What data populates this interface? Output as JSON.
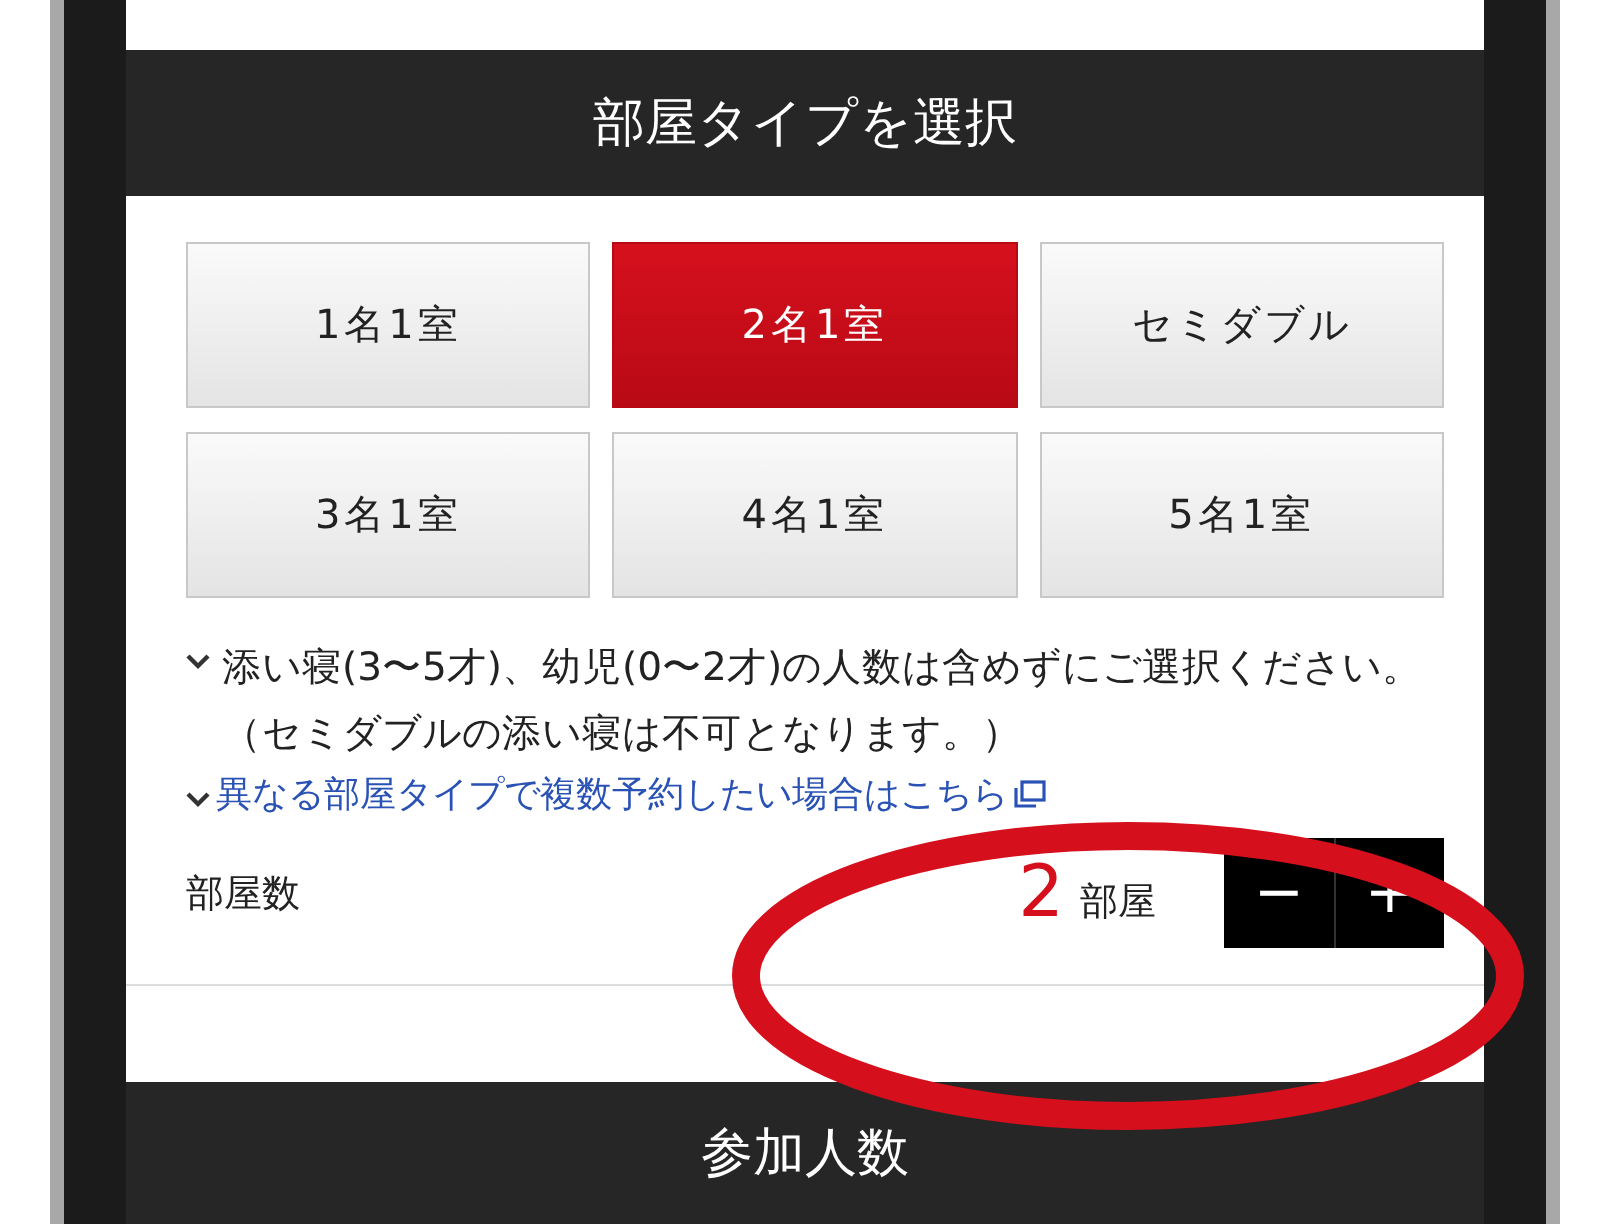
{
  "section_header": {
    "title": "部屋タイプを選択"
  },
  "room_types": [
    {
      "label": "1名1室",
      "selected": false
    },
    {
      "label": "2名1室",
      "selected": true
    },
    {
      "label": "セミダブル",
      "selected": false
    },
    {
      "label": "3名1室",
      "selected": false
    },
    {
      "label": "4名1室",
      "selected": false
    },
    {
      "label": "5名1室",
      "selected": false
    }
  ],
  "note": "添い寝(3〜5才)、幼児(0〜2才)の人数は含めずにご選択ください。（セミダブルの添い寝は不可となります。）",
  "link": "異なる部屋タイプで複数予約したい場合はこちら",
  "room_count": {
    "label": "部屋数",
    "value": "2",
    "unit": "部屋",
    "minus": "−",
    "plus": "+"
  },
  "next_section": {
    "title": "参加人数"
  },
  "annotations": [
    {
      "kind": "ellipse"
    }
  ]
}
